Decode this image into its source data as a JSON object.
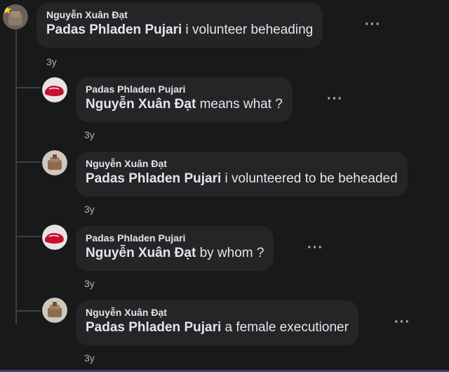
{
  "comments": [
    {
      "author": "Nguyễn Xuân Đạt",
      "mention": "Padas Phladen Pujari",
      "text": " i volunteer beheading",
      "time": "3y",
      "more": "···",
      "avatar": "star-badge-avatar-icon"
    },
    {
      "author": "Padas Phladen Pujari",
      "mention": "Nguyễn Xuân Đạt",
      "text": " means what ?",
      "time": "3y",
      "more": "···",
      "avatar": "red-avatar-icon"
    },
    {
      "author": "Nguyễn Xuân Đạt",
      "mention": "Padas Phladen Pujari",
      "text": " i volunteered to be beheaded",
      "time": "3y",
      "more": "···",
      "avatar": "brown-avatar-icon"
    },
    {
      "author": "Padas Phladen Pujari",
      "mention": "Nguyễn Xuân Đạt",
      "text": " by whom ?",
      "time": "3y",
      "more": "···",
      "avatar": "red-avatar-icon"
    },
    {
      "author": "Nguyễn Xuân Đạt",
      "mention": "Padas Phladen Pujari",
      "text": " a female executioner",
      "time": "3y",
      "more": "···",
      "avatar": "brown-avatar-icon"
    }
  ],
  "colors": {
    "background": "#18191a",
    "bubble": "#242526",
    "text": "#e4e6eb",
    "secondary": "#b0b3b8",
    "thread_line": "#3e4042"
  }
}
